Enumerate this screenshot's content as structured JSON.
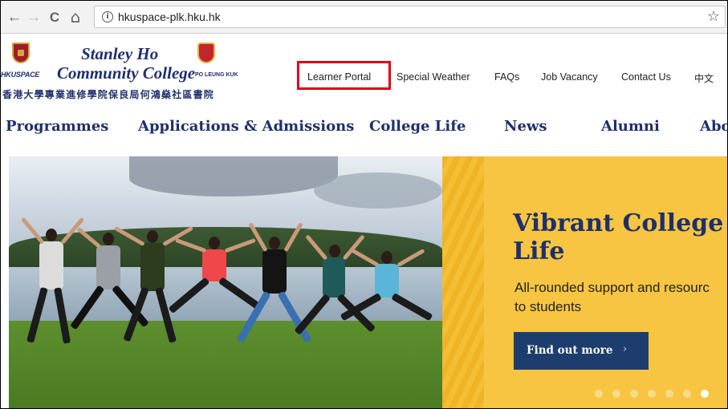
{
  "browser": {
    "url": "hkuspace-plk.hku.hk",
    "back_icon": "←",
    "forward_icon": "→",
    "reload_icon": "C",
    "home_icon": "⌂",
    "info_icon": "i",
    "star_icon": "☆"
  },
  "logo": {
    "line1": "Stanley Ho",
    "line2": "Community College",
    "hkuspace": "HKUSPACE",
    "plk": "PO LEUNG KUK",
    "chinese": "香港大學專業進修學院保良局何鴻燊社區書院"
  },
  "topnav": [
    "Learner Portal",
    "Special Weather",
    "FAQs",
    "Job Vacancy",
    "Contact Us",
    "中文"
  ],
  "mainnav": [
    "Programmes",
    "Applications & Admissions",
    "College Life",
    "News",
    "Alumni",
    "Abo"
  ],
  "promo": {
    "title_line1": "Vibrant College",
    "title_line2": "Life",
    "text_line1": "All-rounded support and resourc",
    "text_line2": "to students",
    "cta": "Find out more",
    "cta_arrow": "›",
    "dots_total": 7,
    "active_dot": 7
  },
  "colors": {
    "brand_navy": "#1e2f6e",
    "promo_yellow": "#f7c541",
    "cta_blue": "#1e3d6f",
    "highlight_red": "#e0001a"
  }
}
